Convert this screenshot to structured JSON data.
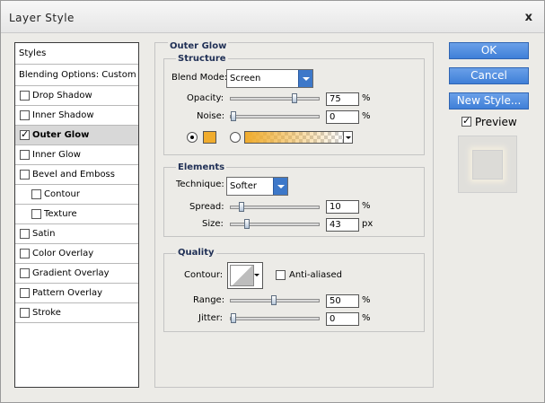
{
  "window": {
    "title": "Layer Style",
    "close_label": "x"
  },
  "styles_list": {
    "header": "Styles",
    "blending": "Blending Options: Custom",
    "items": [
      {
        "label": "Drop Shadow",
        "checked": false,
        "selected": false,
        "sub": false
      },
      {
        "label": "Inner Shadow",
        "checked": false,
        "selected": false,
        "sub": false
      },
      {
        "label": "Outer Glow",
        "checked": true,
        "selected": true,
        "sub": false
      },
      {
        "label": "Inner Glow",
        "checked": false,
        "selected": false,
        "sub": false
      },
      {
        "label": "Bevel and Emboss",
        "checked": false,
        "selected": false,
        "sub": false
      },
      {
        "label": "Contour",
        "checked": false,
        "selected": false,
        "sub": true
      },
      {
        "label": "Texture",
        "checked": false,
        "selected": false,
        "sub": true
      },
      {
        "label": "Satin",
        "checked": false,
        "selected": false,
        "sub": false
      },
      {
        "label": "Color Overlay",
        "checked": false,
        "selected": false,
        "sub": false
      },
      {
        "label": "Gradient Overlay",
        "checked": false,
        "selected": false,
        "sub": false
      },
      {
        "label": "Pattern Overlay",
        "checked": false,
        "selected": false,
        "sub": false
      },
      {
        "label": "Stroke",
        "checked": false,
        "selected": false,
        "sub": false
      }
    ]
  },
  "outer_glow": {
    "title": "Outer Glow",
    "structure": {
      "title": "Structure",
      "blend_mode_label": "Blend Mode:",
      "blend_mode_value": "Screen",
      "opacity_label": "Opacity:",
      "opacity_value": "75",
      "opacity_fraction": 0.75,
      "opacity_unit": "%",
      "noise_label": "Noise:",
      "noise_value": "0",
      "noise_fraction": 0,
      "noise_unit": "%",
      "glow_color": "#f0ac2d"
    },
    "elements": {
      "title": "Elements",
      "technique_label": "Technique:",
      "technique_value": "Softer",
      "spread_label": "Spread:",
      "spread_value": "10",
      "spread_fraction": 0.1,
      "spread_unit": "%",
      "size_label": "Size:",
      "size_value": "43",
      "size_fraction": 0.17,
      "size_unit": "px"
    },
    "quality": {
      "title": "Quality",
      "contour_label": "Contour:",
      "anti_aliased_label": "Anti-aliased",
      "anti_aliased": false,
      "range_label": "Range:",
      "range_value": "50",
      "range_fraction": 0.5,
      "range_unit": "%",
      "jitter_label": "Jitter:",
      "jitter_value": "0",
      "jitter_fraction": 0,
      "jitter_unit": "%"
    }
  },
  "buttons": {
    "ok": "OK",
    "cancel": "Cancel",
    "new_style": "New Style...",
    "preview_label": "Preview",
    "preview_checked": true
  }
}
